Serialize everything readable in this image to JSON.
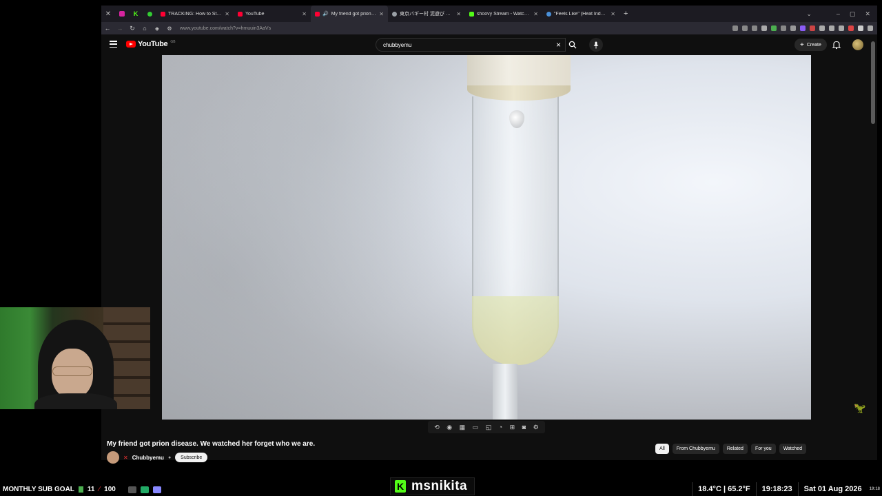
{
  "browser": {
    "tabs": [
      {
        "title": "TRACKING: How to Stick an IMA",
        "color": "#ff0033"
      },
      {
        "title": "YouTube",
        "color": "#ff0033"
      },
      {
        "title": "My friend got prion disease",
        "color": "#ff0033",
        "active": true
      },
      {
        "title": "東京バギー村 泥遊び 泥撮影 - Y",
        "color": "#9aa0a6"
      },
      {
        "title": "shoovy Stream - Watch Live on",
        "color": "#53fc18"
      },
      {
        "title": "\"Feels Like\" (Heat Index) Tempe",
        "color": "#4a90d9"
      }
    ],
    "url": "www.youtube.com/watch?v=hmuuin3AaVs"
  },
  "youtube": {
    "logo_text": "YouTube",
    "logo_country": "GB",
    "search_value": "chubbyemu",
    "create_label": "Create",
    "video_title": "My friend got prion disease. We watched her forget who we are.",
    "channel_name": "Chubbyemu",
    "subscribe_label": "Subscribe",
    "chips": [
      "All",
      "From Chubbyemu",
      "Related",
      "For you",
      "Watched"
    ]
  },
  "overlay": {
    "sub_goal_label": "MONTHLY SUB GOAL",
    "sub_current": "11",
    "sub_target": "100",
    "kick_username": "msnikita",
    "temperature": "18.4°C | 65.2°F",
    "time": "19:18:23",
    "date": "Sat 01 Aug 2026",
    "corner_time": "19:18"
  },
  "colors": {
    "kick_green": "#53fc18",
    "youtube_red": "#ff0000"
  }
}
